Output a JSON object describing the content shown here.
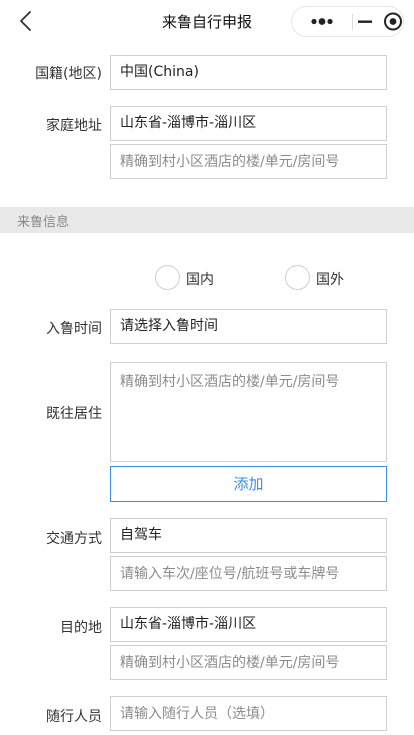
{
  "header": {
    "title": "来鲁自行申报",
    "back_icon": "chevron-left-icon",
    "more_icon": "more-dots-icon",
    "minimize_icon": "minus-icon",
    "close_icon": "target-circle-icon"
  },
  "form": {
    "nationality": {
      "label": "国籍(地区)",
      "value": "中国(China)"
    },
    "home_address": {
      "label": "家庭地址",
      "value": "山东省-淄博市-淄川区",
      "detail_placeholder": "精确到村小区酒店的楼/单元/房间号"
    }
  },
  "section": {
    "title": "来鲁信息"
  },
  "origin": {
    "options": [
      {
        "label": "国内",
        "selected": false
      },
      {
        "label": "国外",
        "selected": false
      }
    ]
  },
  "arrival": {
    "label": "入鲁时间",
    "value": "请选择入鲁时间"
  },
  "previous_residence": {
    "label": "既往居住",
    "placeholder": "精确到村小区酒店的楼/单元/房间号",
    "add_label": "添加"
  },
  "transport": {
    "label": "交通方式",
    "value": "自驾车",
    "detail_placeholder": "请输入车次/座位号/航班号或车牌号"
  },
  "destination": {
    "label": "目的地",
    "value": "山东省-淄博市-淄川区",
    "detail_placeholder": "精确到村小区酒店的楼/单元/房间号"
  },
  "companions": {
    "label": "随行人员",
    "placeholder": "请输入随行人员（选填）"
  },
  "colors": {
    "accent": "#3a8ee6",
    "section_bg": "#e8e8e8",
    "border": "#cfcfcf"
  }
}
